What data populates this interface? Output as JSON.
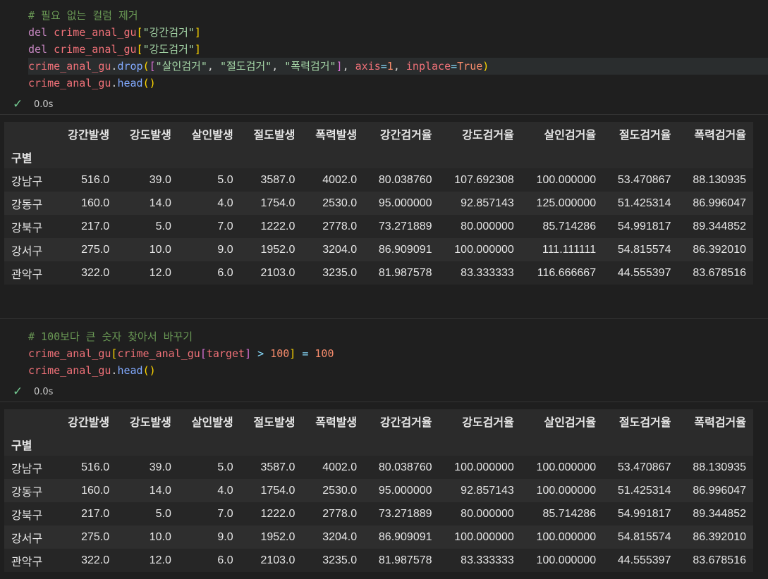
{
  "cell1": {
    "comment": "# 필요 없는 컬럼 제거",
    "line1": {
      "kw": "del",
      "var": "crime_anal_gu",
      "str": "\"강간검거\""
    },
    "line2": {
      "kw": "del",
      "var": "crime_anal_gu",
      "str": "\"강도검거\""
    },
    "line3": {
      "var": "crime_anal_gu",
      "fn": "drop",
      "s1": "\"살인검거\"",
      "s2": "\"절도검거\"",
      "s3": "\"폭력검거\"",
      "p1": "axis",
      "n1": "1",
      "p2": "inplace",
      "b1": "True"
    },
    "line4": {
      "var": "crime_anal_gu",
      "fn": "head"
    },
    "status": "0.0s"
  },
  "cell2": {
    "comment": "# 100보다 큰 숫자 찾아서 바꾸기",
    "line1": {
      "var": "crime_anal_gu",
      "var2": "crime_anal_gu",
      "target": "target",
      "op": ">",
      "n1": "100",
      "n2": "100"
    },
    "line2": {
      "var": "crime_anal_gu",
      "fn": "head"
    },
    "status": "0.0s"
  },
  "table_columns": [
    "강간발생",
    "강도발생",
    "살인발생",
    "절도발생",
    "폭력발생",
    "강간검거율",
    "강도검거율",
    "살인검거율",
    "절도검거율",
    "폭력검거율"
  ],
  "index_name": "구별",
  "table1": [
    [
      "강남구",
      "516.0",
      "39.0",
      "5.0",
      "3587.0",
      "4002.0",
      "80.038760",
      "107.692308",
      "100.000000",
      "53.470867",
      "88.130935"
    ],
    [
      "강동구",
      "160.0",
      "14.0",
      "4.0",
      "1754.0",
      "2530.0",
      "95.000000",
      "92.857143",
      "125.000000",
      "51.425314",
      "86.996047"
    ],
    [
      "강북구",
      "217.0",
      "5.0",
      "7.0",
      "1222.0",
      "2778.0",
      "73.271889",
      "80.000000",
      "85.714286",
      "54.991817",
      "89.344852"
    ],
    [
      "강서구",
      "275.0",
      "10.0",
      "9.0",
      "1952.0",
      "3204.0",
      "86.909091",
      "100.000000",
      "111.111111",
      "54.815574",
      "86.392010"
    ],
    [
      "관악구",
      "322.0",
      "12.0",
      "6.0",
      "2103.0",
      "3235.0",
      "81.987578",
      "83.333333",
      "116.666667",
      "44.555397",
      "83.678516"
    ]
  ],
  "table2": [
    [
      "강남구",
      "516.0",
      "39.0",
      "5.0",
      "3587.0",
      "4002.0",
      "80.038760",
      "100.000000",
      "100.000000",
      "53.470867",
      "88.130935"
    ],
    [
      "강동구",
      "160.0",
      "14.0",
      "4.0",
      "1754.0",
      "2530.0",
      "95.000000",
      "92.857143",
      "100.000000",
      "51.425314",
      "86.996047"
    ],
    [
      "강북구",
      "217.0",
      "5.0",
      "7.0",
      "1222.0",
      "2778.0",
      "73.271889",
      "80.000000",
      "85.714286",
      "54.991817",
      "89.344852"
    ],
    [
      "강서구",
      "275.0",
      "10.0",
      "9.0",
      "1952.0",
      "3204.0",
      "86.909091",
      "100.000000",
      "100.000000",
      "54.815574",
      "86.392010"
    ],
    [
      "관악구",
      "322.0",
      "12.0",
      "6.0",
      "2103.0",
      "3235.0",
      "81.987578",
      "83.333333",
      "100.000000",
      "44.555397",
      "83.678516"
    ]
  ]
}
